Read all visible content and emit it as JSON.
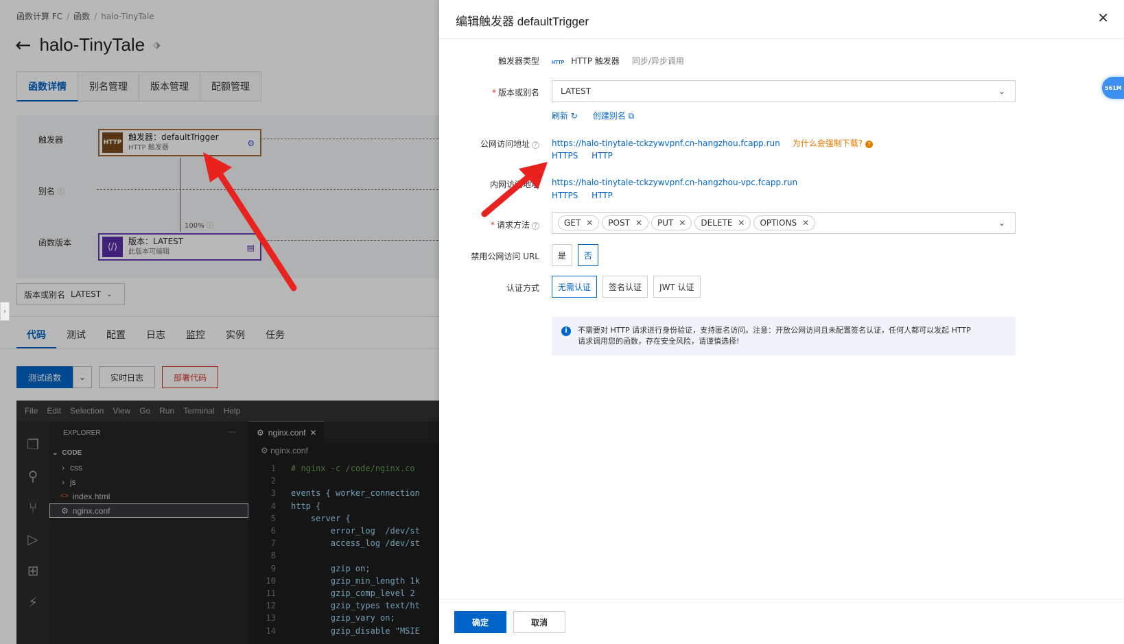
{
  "background": {
    "breadcrumb": [
      "函数计算 FC",
      "函数",
      "halo-TinyTale"
    ],
    "title": "halo-TinyTale",
    "main_tabs": [
      "函数详情",
      "别名管理",
      "版本管理",
      "配额管理"
    ],
    "flow": {
      "trigger_row_label": "触发器",
      "alias_row_label": "别名",
      "version_row_label": "函数版本",
      "trigger_icon_text": "HTTP",
      "trigger_name": "触发器：defaultTrigger",
      "trigger_type": "HTTP 触发器",
      "traffic_percent": "100%",
      "version_name": "版本：LATEST",
      "version_note": "此版本可编辑"
    },
    "version_selector": {
      "label": "版本或别名",
      "value": "LATEST"
    },
    "code_tabs": [
      "代码",
      "测试",
      "配置",
      "日志",
      "监控",
      "实例",
      "任务"
    ],
    "buttons": {
      "test": "测试函数",
      "realtime_log": "实时日志",
      "deploy": "部署代码"
    },
    "ide": {
      "menu": [
        "File",
        "Edit",
        "Selection",
        "View",
        "Go",
        "Run",
        "Terminal",
        "Help"
      ],
      "explorer_title": "EXPLORER",
      "folder": "CODE",
      "files": [
        "css",
        "js",
        "index.html",
        "nginx.conf"
      ],
      "open_tab": "nginx.conf",
      "breadcrumb": "nginx.conf",
      "line_numbers": [
        "1",
        "2",
        "3",
        "4",
        "5",
        "6",
        "7",
        "8",
        "9",
        "10",
        "11",
        "12",
        "13",
        "14"
      ],
      "code_lines": [
        "# nginx -c /code/nginx.co",
        "",
        "events { worker_connection",
        "http {",
        "    server {",
        "        error_log  /dev/st",
        "        access_log /dev/st",
        "",
        "        gzip on;",
        "        gzip_min_length 1k",
        "        gzip_comp_level 2",
        "        gzip_types text/ht",
        "        gzip_vary on;",
        "        gzip_disable \"MSIE"
      ]
    }
  },
  "drawer": {
    "title": "编辑触发器 defaultTrigger",
    "trigger_type": {
      "label": "触发器类型",
      "badge": "HTTP",
      "value": "HTTP 触发器",
      "extra": "同步/异步调用"
    },
    "version_alias": {
      "label": "版本或别名",
      "value": "LATEST",
      "refresh": "刷新",
      "create_alias": "创建别名"
    },
    "public_url": {
      "label": "公网访问地址",
      "url": "https://halo-tinytale-tckzywvpnf.cn-hangzhou.fcapp.run",
      "warning": "为什么会强制下载?",
      "protocols": [
        "HTTPS",
        "HTTP"
      ]
    },
    "private_url": {
      "label": "内网访问地址",
      "url": "https://halo-tinytale-tckzywvpnf.cn-hangzhou-vpc.fcapp.run",
      "protocols": [
        "HTTPS",
        "HTTP"
      ]
    },
    "methods": {
      "label": "请求方法",
      "values": [
        "GET",
        "POST",
        "PUT",
        "DELETE",
        "OPTIONS"
      ]
    },
    "disable_public_url": {
      "label": "禁用公网访问 URL",
      "options": [
        "是",
        "否"
      ],
      "selected": "否"
    },
    "auth": {
      "label": "认证方式",
      "options": [
        "无需认证",
        "签名认证",
        "JWT 认证"
      ],
      "selected": "无需认证"
    },
    "info_text_1": "不需要对 HTTP 请求进行身份验证，支持匿名访问。注意：开放公网访问且未配置签名认证，任何人都可以发起 HTTP",
    "info_text_2": "请求调用您的函数，存在安全风险，请谨慎选择!",
    "ok": "确定",
    "cancel": "取消",
    "memory_badge": "561M"
  }
}
